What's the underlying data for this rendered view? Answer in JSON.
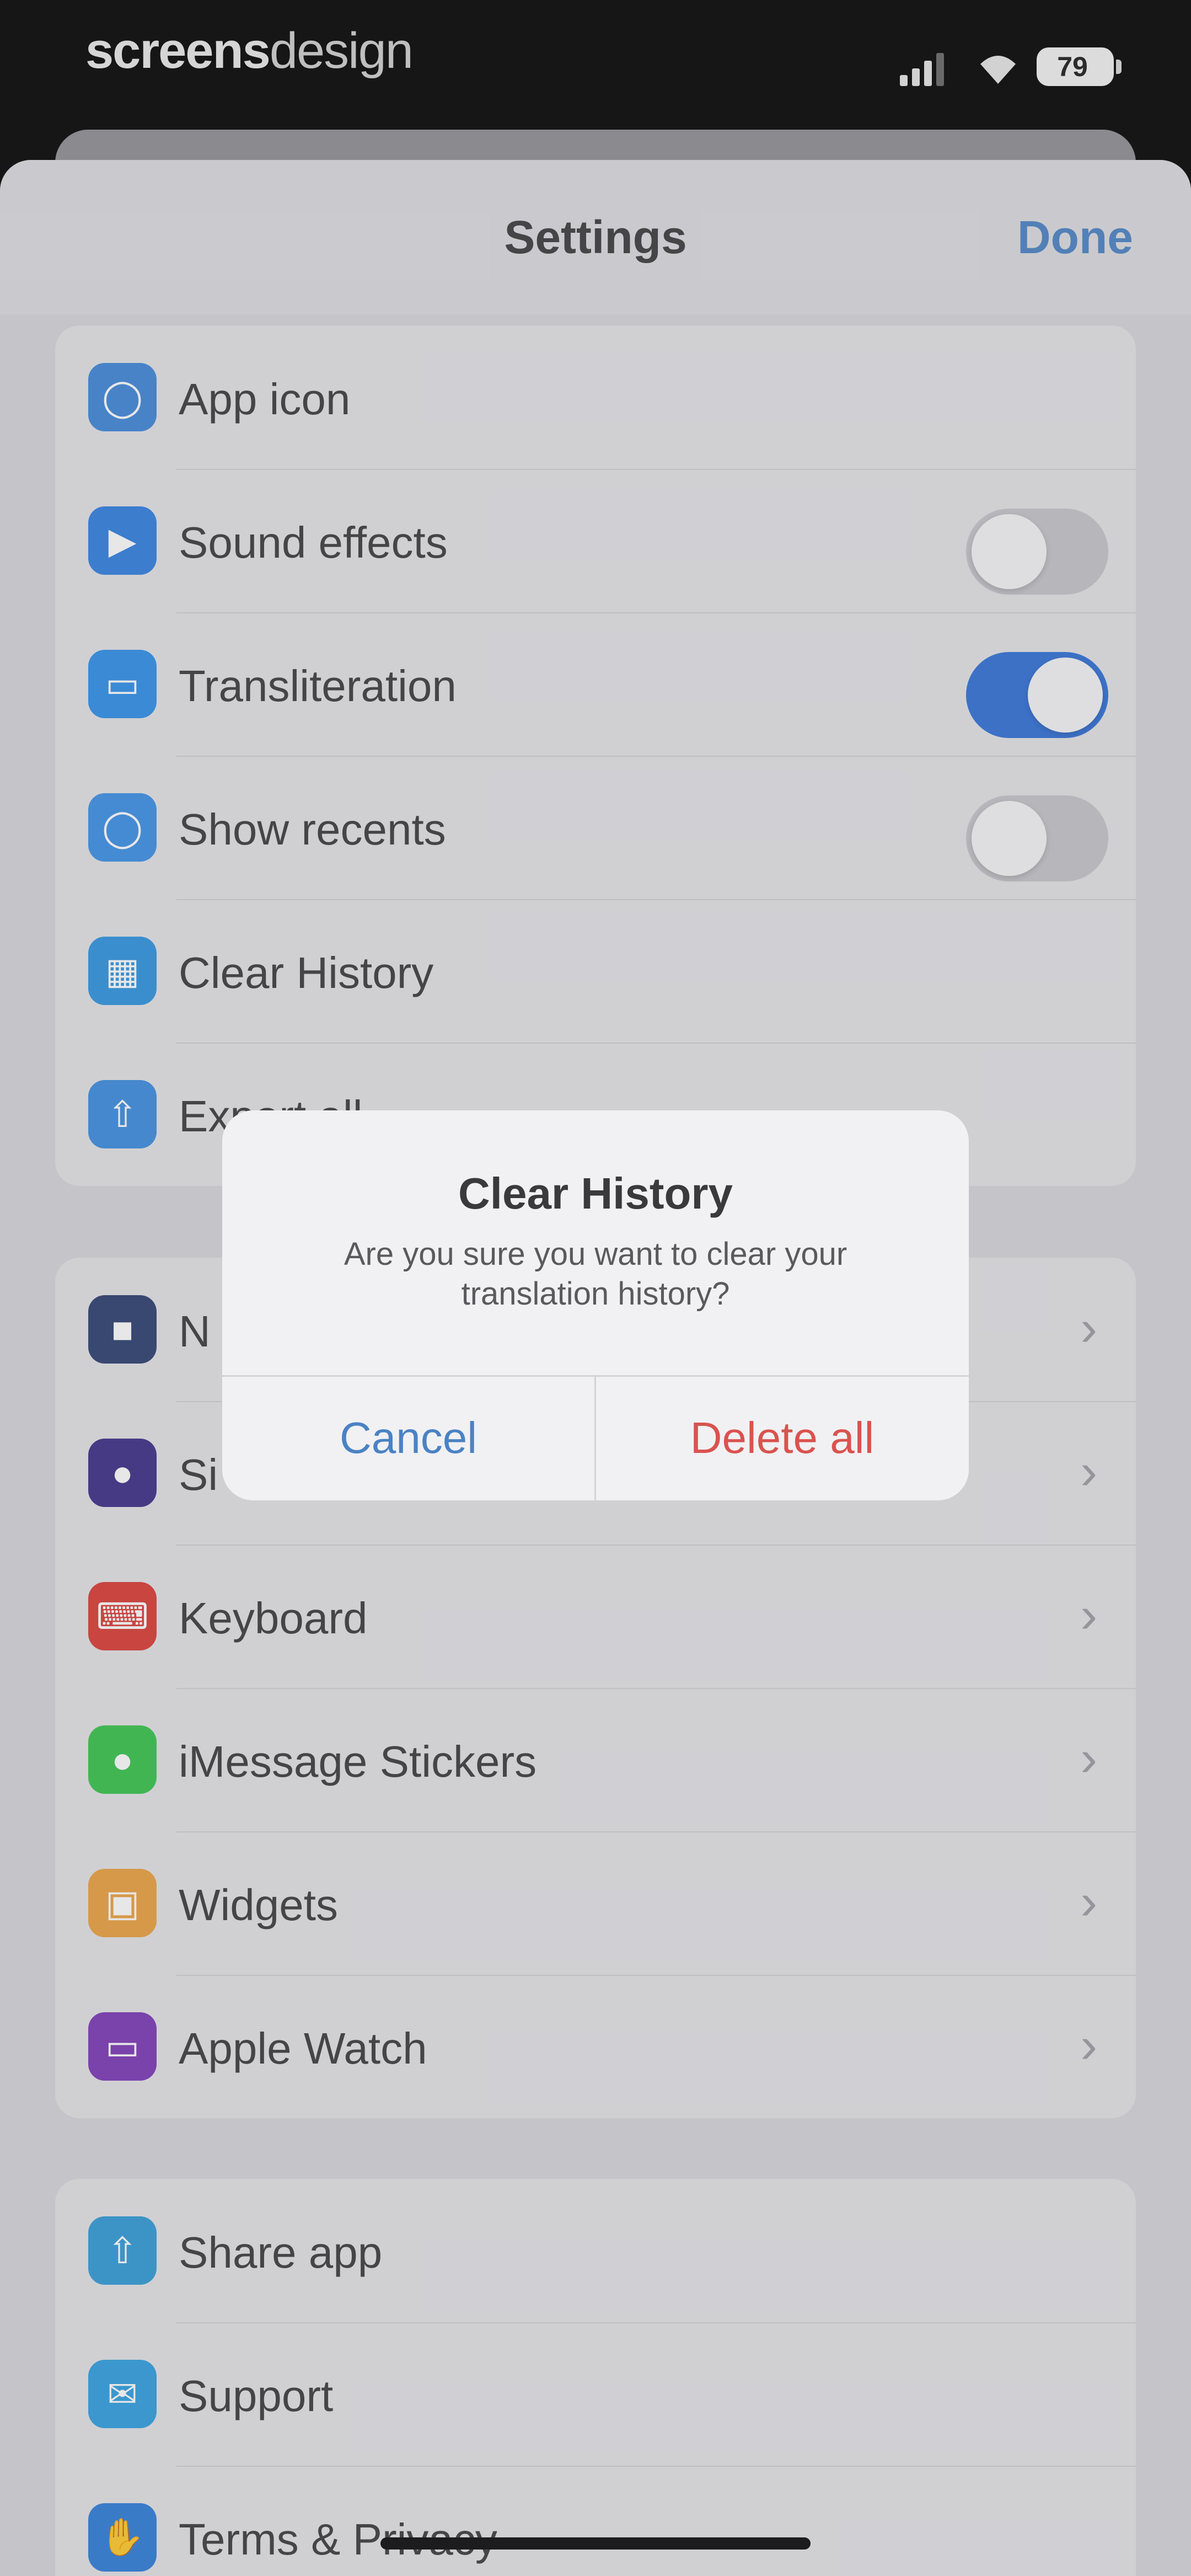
{
  "status_bar": {
    "brand_bold": "screens",
    "brand_light": "design",
    "battery": "79"
  },
  "nav": {
    "title": "Settings",
    "done": "Done"
  },
  "settings_group": [
    {
      "label": "App icon",
      "icon": "app-icon-icon",
      "color": "#3d86d8"
    },
    {
      "label": "Sound effects",
      "icon": "speaker-icon",
      "color": "#2f7ee0",
      "toggle": false
    },
    {
      "label": "Transliteration",
      "icon": "speech-bubble-icon",
      "color": "#2d8ee8",
      "toggle": true
    },
    {
      "label": "Show recents",
      "icon": "clock-icon",
      "color": "#3a8fe6",
      "toggle": false
    },
    {
      "label": "Clear History",
      "icon": "trash-icon",
      "color": "#2e93df"
    },
    {
      "label": "Export all",
      "icon": "share-icon",
      "color": "#3a8be0"
    }
  ],
  "features_group": [
    {
      "label": "N",
      "icon": "notifications-icon",
      "color": "#2b3e6e"
    },
    {
      "label": "Si",
      "icon": "siri-icon",
      "color": "#3b2c85"
    },
    {
      "label": "Keyboard",
      "icon": "keyboard-icon",
      "color": "#d93a33"
    },
    {
      "label": "iMessage Stickers",
      "icon": "message-icon",
      "color": "#36c24a"
    },
    {
      "label": "Widgets",
      "icon": "widgets-icon",
      "color": "#eba03d"
    },
    {
      "label": "Apple Watch",
      "icon": "watch-icon",
      "color": "#7a36b5"
    }
  ],
  "about_group": [
    {
      "label": "Share app",
      "icon": "share-app-icon",
      "color": "#2f9ad6"
    },
    {
      "label": "Support",
      "icon": "mail-icon",
      "color": "#2e9ee0"
    },
    {
      "label": "Terms & Privacy",
      "icon": "hand-icon",
      "color": "#2d7cd8"
    }
  ],
  "alert": {
    "title": "Clear History",
    "message": "Are you sure you want to clear your translation history?",
    "cancel": "Cancel",
    "confirm": "Delete all"
  }
}
